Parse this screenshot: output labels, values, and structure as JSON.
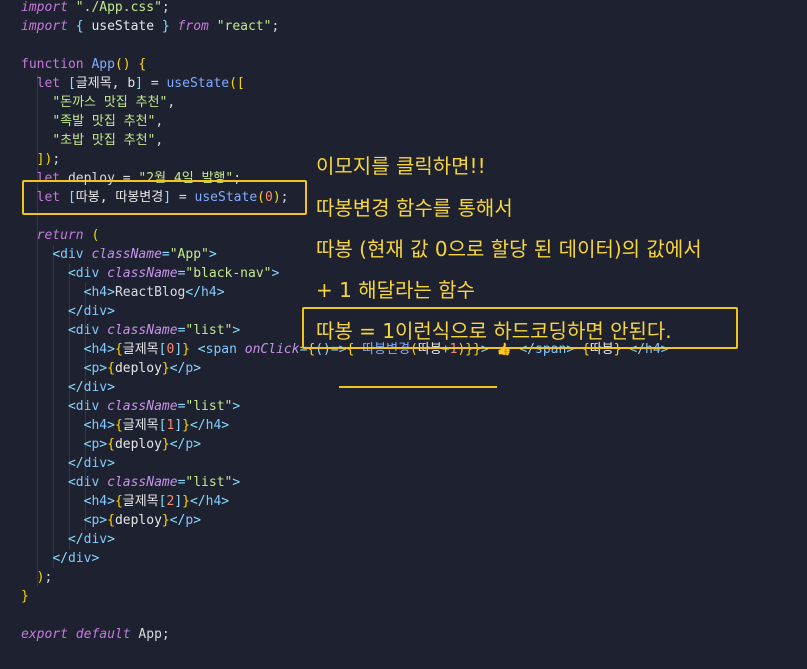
{
  "code_lines": [
    {
      "y": 0,
      "segs": [
        [
          "kwi",
          "import"
        ],
        [
          "plain",
          " "
        ],
        [
          "str",
          "\"./App.css\""
        ],
        [
          "plain",
          ";"
        ]
      ]
    },
    {
      "y": 1,
      "segs": [
        [
          "kwi",
          "import"
        ],
        [
          "plain",
          " "
        ],
        [
          "punc",
          "{"
        ],
        [
          "var",
          " useState "
        ],
        [
          "punc",
          "}"
        ],
        [
          "kwi",
          " from"
        ],
        [
          "plain",
          " "
        ],
        [
          "str",
          "\"react\""
        ],
        [
          "plain",
          ";"
        ]
      ]
    },
    {
      "y": 3,
      "segs": [
        [
          "kw",
          "function"
        ],
        [
          "plain",
          " "
        ],
        [
          "fn",
          "App"
        ],
        [
          "brace",
          "()"
        ],
        [
          "plain",
          " "
        ],
        [
          "brace",
          "{"
        ]
      ]
    },
    {
      "y": 4,
      "segs": [
        [
          "plain",
          "  "
        ],
        [
          "kw",
          "let"
        ],
        [
          "plain",
          " "
        ],
        [
          "punc",
          "["
        ],
        [
          "var",
          "글제목, b"
        ],
        [
          "punc",
          "]"
        ],
        [
          "plain",
          " = "
        ],
        [
          "fn",
          "useState"
        ],
        [
          "brace",
          "(["
        ]
      ]
    },
    {
      "y": 5,
      "segs": [
        [
          "plain",
          "    "
        ],
        [
          "str",
          "\"돈까스 맛집 추천\""
        ],
        [
          "plain",
          ","
        ]
      ]
    },
    {
      "y": 6,
      "segs": [
        [
          "plain",
          "    "
        ],
        [
          "str",
          "\"족발 맛집 추천\""
        ],
        [
          "plain",
          ","
        ]
      ]
    },
    {
      "y": 7,
      "segs": [
        [
          "plain",
          "    "
        ],
        [
          "str",
          "\"초밥 맛집 추천\""
        ],
        [
          "plain",
          ","
        ]
      ]
    },
    {
      "y": 8,
      "segs": [
        [
          "plain",
          "  "
        ],
        [
          "brace",
          "])"
        ],
        [
          "plain",
          ";"
        ]
      ]
    },
    {
      "y": 9,
      "segs": [
        [
          "plain",
          "  "
        ],
        [
          "kw",
          "let"
        ],
        [
          "plain",
          " deploy = "
        ],
        [
          "str",
          "\"2월 4일 발행\""
        ],
        [
          "plain",
          ";"
        ]
      ]
    },
    {
      "y": 10,
      "segs": [
        [
          "plain",
          "  "
        ],
        [
          "kw",
          "let"
        ],
        [
          "plain",
          " "
        ],
        [
          "punc",
          "["
        ],
        [
          "var",
          "따봉, 따봉변경"
        ],
        [
          "punc",
          "]"
        ],
        [
          "plain",
          " = "
        ],
        [
          "fn",
          "useState"
        ],
        [
          "brace",
          "("
        ],
        [
          "num",
          "0"
        ],
        [
          "brace",
          ")"
        ],
        [
          "plain",
          ";"
        ]
      ]
    },
    {
      "y": 12,
      "segs": [
        [
          "plain",
          "  "
        ],
        [
          "kwi",
          "return"
        ],
        [
          "plain",
          " "
        ],
        [
          "brace",
          "("
        ]
      ]
    },
    {
      "y": 13,
      "segs": [
        [
          "plain",
          "    "
        ],
        [
          "punc",
          "<"
        ],
        [
          "tag",
          "div"
        ],
        [
          "plain",
          " "
        ],
        [
          "attr",
          "className"
        ],
        [
          "punc",
          "="
        ],
        [
          "str",
          "\"App\""
        ],
        [
          "punc",
          ">"
        ]
      ]
    },
    {
      "y": 14,
      "segs": [
        [
          "plain",
          "      "
        ],
        [
          "punc",
          "<"
        ],
        [
          "tag",
          "div"
        ],
        [
          "plain",
          " "
        ],
        [
          "attr",
          "className"
        ],
        [
          "punc",
          "="
        ],
        [
          "str",
          "\"black-nav\""
        ],
        [
          "punc",
          ">"
        ]
      ]
    },
    {
      "y": 15,
      "segs": [
        [
          "plain",
          "        "
        ],
        [
          "punc",
          "<"
        ],
        [
          "tag",
          "h4"
        ],
        [
          "punc",
          ">"
        ],
        [
          "plain",
          "ReactBlog"
        ],
        [
          "punc",
          "</"
        ],
        [
          "tag",
          "h4"
        ],
        [
          "punc",
          ">"
        ]
      ]
    },
    {
      "y": 16,
      "segs": [
        [
          "plain",
          "      "
        ],
        [
          "punc",
          "</"
        ],
        [
          "tag",
          "div"
        ],
        [
          "punc",
          ">"
        ]
      ]
    },
    {
      "y": 17,
      "segs": [
        [
          "plain",
          "      "
        ],
        [
          "punc",
          "<"
        ],
        [
          "tag",
          "div"
        ],
        [
          "plain",
          " "
        ],
        [
          "attr",
          "className"
        ],
        [
          "punc",
          "="
        ],
        [
          "str",
          "\"list\""
        ],
        [
          "punc",
          ">"
        ]
      ]
    },
    {
      "y": 18,
      "segs": [
        [
          "plain",
          "        "
        ],
        [
          "punc",
          "<"
        ],
        [
          "tag",
          "h4"
        ],
        [
          "punc",
          ">"
        ],
        [
          "brace",
          "{"
        ],
        [
          "var",
          "글제목"
        ],
        [
          "punc",
          "["
        ],
        [
          "num",
          "0"
        ],
        [
          "punc",
          "]"
        ],
        [
          "brace",
          "}"
        ],
        [
          "plain",
          " "
        ],
        [
          "punc",
          "<"
        ],
        [
          "tag",
          "span"
        ],
        [
          "plain",
          " "
        ],
        [
          "attr",
          "onClick"
        ],
        [
          "punc",
          "="
        ],
        [
          "brace",
          "{"
        ],
        [
          "punc",
          "()=>"
        ],
        [
          "brace",
          "{"
        ],
        [
          "plain",
          " "
        ],
        [
          "fn",
          "따봉변경"
        ],
        [
          "brace",
          "("
        ],
        [
          "var",
          "따봉"
        ],
        [
          "punc",
          "+"
        ],
        [
          "num",
          "1"
        ],
        [
          "brace",
          ")}}"
        ],
        [
          "punc",
          ">"
        ],
        [
          "plain",
          " "
        ],
        [
          "emoji",
          "👍"
        ],
        [
          "plain",
          " "
        ],
        [
          "punc",
          "</"
        ],
        [
          "tag",
          "span"
        ],
        [
          "punc",
          ">"
        ],
        [
          "plain",
          " "
        ],
        [
          "brace",
          "{"
        ],
        [
          "var",
          "따봉"
        ],
        [
          "brace",
          "}"
        ],
        [
          "plain",
          " "
        ],
        [
          "punc",
          "</"
        ],
        [
          "tag",
          "h4"
        ],
        [
          "punc",
          ">"
        ]
      ]
    },
    {
      "y": 19,
      "segs": [
        [
          "plain",
          "        "
        ],
        [
          "punc",
          "<"
        ],
        [
          "tag",
          "p"
        ],
        [
          "punc",
          ">"
        ],
        [
          "brace",
          "{"
        ],
        [
          "var",
          "deploy"
        ],
        [
          "brace",
          "}"
        ],
        [
          "punc",
          "</"
        ],
        [
          "tag",
          "p"
        ],
        [
          "punc",
          ">"
        ]
      ]
    },
    {
      "y": 20,
      "segs": [
        [
          "plain",
          "      "
        ],
        [
          "punc",
          "</"
        ],
        [
          "tag",
          "div"
        ],
        [
          "punc",
          ">"
        ]
      ]
    },
    {
      "y": 21,
      "segs": [
        [
          "plain",
          "      "
        ],
        [
          "punc",
          "<"
        ],
        [
          "tag",
          "div"
        ],
        [
          "plain",
          " "
        ],
        [
          "attr",
          "className"
        ],
        [
          "punc",
          "="
        ],
        [
          "str",
          "\"list\""
        ],
        [
          "punc",
          ">"
        ]
      ]
    },
    {
      "y": 22,
      "segs": [
        [
          "plain",
          "        "
        ],
        [
          "punc",
          "<"
        ],
        [
          "tag",
          "h4"
        ],
        [
          "punc",
          ">"
        ],
        [
          "brace",
          "{"
        ],
        [
          "var",
          "글제목"
        ],
        [
          "punc",
          "["
        ],
        [
          "num",
          "1"
        ],
        [
          "punc",
          "]"
        ],
        [
          "brace",
          "}"
        ],
        [
          "punc",
          "</"
        ],
        [
          "tag",
          "h4"
        ],
        [
          "punc",
          ">"
        ]
      ]
    },
    {
      "y": 23,
      "segs": [
        [
          "plain",
          "        "
        ],
        [
          "punc",
          "<"
        ],
        [
          "tag",
          "p"
        ],
        [
          "punc",
          ">"
        ],
        [
          "brace",
          "{"
        ],
        [
          "var",
          "deploy"
        ],
        [
          "brace",
          "}"
        ],
        [
          "punc",
          "</"
        ],
        [
          "tag",
          "p"
        ],
        [
          "punc",
          ">"
        ]
      ]
    },
    {
      "y": 24,
      "segs": [
        [
          "plain",
          "      "
        ],
        [
          "punc",
          "</"
        ],
        [
          "tag",
          "div"
        ],
        [
          "punc",
          ">"
        ]
      ]
    },
    {
      "y": 25,
      "segs": [
        [
          "plain",
          "      "
        ],
        [
          "punc",
          "<"
        ],
        [
          "tag",
          "div"
        ],
        [
          "plain",
          " "
        ],
        [
          "attr",
          "className"
        ],
        [
          "punc",
          "="
        ],
        [
          "str",
          "\"list\""
        ],
        [
          "punc",
          ">"
        ]
      ]
    },
    {
      "y": 26,
      "segs": [
        [
          "plain",
          "        "
        ],
        [
          "punc",
          "<"
        ],
        [
          "tag",
          "h4"
        ],
        [
          "punc",
          ">"
        ],
        [
          "brace",
          "{"
        ],
        [
          "var",
          "글제목"
        ],
        [
          "punc",
          "["
        ],
        [
          "num",
          "2"
        ],
        [
          "punc",
          "]"
        ],
        [
          "brace",
          "}"
        ],
        [
          "punc",
          "</"
        ],
        [
          "tag",
          "h4"
        ],
        [
          "punc",
          ">"
        ]
      ]
    },
    {
      "y": 27,
      "segs": [
        [
          "plain",
          "        "
        ],
        [
          "punc",
          "<"
        ],
        [
          "tag",
          "p"
        ],
        [
          "punc",
          ">"
        ],
        [
          "brace",
          "{"
        ],
        [
          "var",
          "deploy"
        ],
        [
          "brace",
          "}"
        ],
        [
          "punc",
          "</"
        ],
        [
          "tag",
          "p"
        ],
        [
          "punc",
          ">"
        ]
      ]
    },
    {
      "y": 28,
      "segs": [
        [
          "plain",
          "      "
        ],
        [
          "punc",
          "</"
        ],
        [
          "tag",
          "div"
        ],
        [
          "punc",
          ">"
        ]
      ]
    },
    {
      "y": 29,
      "segs": [
        [
          "plain",
          "    "
        ],
        [
          "punc",
          "</"
        ],
        [
          "tag",
          "div"
        ],
        [
          "punc",
          ">"
        ]
      ]
    },
    {
      "y": 30,
      "segs": [
        [
          "plain",
          "  "
        ],
        [
          "brace",
          ")"
        ],
        [
          "plain",
          ";"
        ]
      ]
    },
    {
      "y": 31,
      "segs": [
        [
          "brace",
          "}"
        ]
      ]
    },
    {
      "y": 33,
      "segs": [
        [
          "kwi",
          "export"
        ],
        [
          "plain",
          " "
        ],
        [
          "kwi",
          "default"
        ],
        [
          "plain",
          " App;"
        ]
      ]
    }
  ],
  "notes": {
    "line1": "이모지를 클릭하면!!",
    "line2": "따봉변경 함수를 통해서",
    "line3": "따봉 (현재 값 0으로 할당 된 데이터)의 값에서",
    "line4": "+ 1 해달라는 함수",
    "line5": "따봉 = 1이런식으로 하드코딩하면 안된다."
  },
  "colors": {
    "highlight": "#f2c31a",
    "note_text": "#f7d53c",
    "background": "#1e2130"
  }
}
